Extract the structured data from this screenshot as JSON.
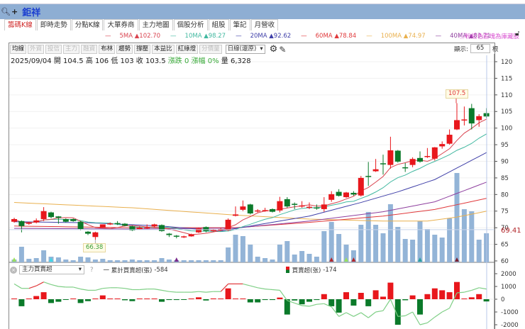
{
  "header": {
    "stock_name": "鉅祥",
    "search_icon": "magnifier",
    "add_icon": "+"
  },
  "tabs": [
    {
      "label": "籌碼K線",
      "active": true
    },
    {
      "label": "即時走勢"
    },
    {
      "label": "分點K線"
    },
    {
      "label": "大單券商"
    },
    {
      "label": "主力地圖"
    },
    {
      "label": "個股分析"
    },
    {
      "label": "組股"
    },
    {
      "label": "筆記"
    },
    {
      "label": "月營收"
    }
  ],
  "legend": [
    {
      "label": "5MA",
      "value": "▲102.70",
      "color": "#d9434f"
    },
    {
      "label": "10MA",
      "value": "▲98.27",
      "color": "#41b8a0"
    },
    {
      "label": "20MA",
      "value": "▲92.62",
      "color": "#3f3fa8"
    },
    {
      "label": "60MA",
      "value": "▲78.84",
      "color": "#e0393b"
    },
    {
      "label": "100MA",
      "value": "▲74.97",
      "color": "#e9b04e"
    },
    {
      "label": "40MA",
      "value": "▲83.71",
      "color": "#8e3f9e"
    }
  ],
  "notice": "ⓘ粉紅色區塊為庫藏股",
  "toolbar": {
    "buttons": [
      {
        "label": "均線"
      },
      {
        "label": "外資",
        "disabled": true
      },
      {
        "label": "投信",
        "disabled": true
      },
      {
        "label": "主力",
        "disabled": true
      },
      {
        "label": "融資",
        "disabled": true
      },
      {
        "label": "布林"
      },
      {
        "label": "趨勢"
      },
      {
        "label": "撐壓"
      },
      {
        "label": "本益比"
      },
      {
        "label": "紅綠燈"
      },
      {
        "label": "分價量",
        "disabled": true
      }
    ],
    "period": "日線(還原)",
    "display_label": "顯示:",
    "display_count": "65",
    "display_unit": "根"
  },
  "info": {
    "date": "2025/09/04",
    "open_label": "開",
    "open": "104.5",
    "high_label": "高",
    "high": "106",
    "low_label": "低",
    "low": "103",
    "close_label": "收",
    "close": "103.5",
    "change_label": "漲跌",
    "change": "0",
    "pct_label": "漲幅",
    "pct": "0%",
    "vol_label": "量",
    "vol": "6,328"
  },
  "lower": {
    "indicator": "主力買賣超",
    "help": "?",
    "cum_label": "一 累計買賣超(張)",
    "cum_value": "-584",
    "net_label": "買賣超(张)",
    "net_value": "-174"
  },
  "colors": {
    "up": "#e8171c",
    "down": "#0b7a2a",
    "volume": "#93b4d7",
    "cum_line": "#7fcf86"
  },
  "chart_data": {
    "type": "candlestick",
    "yticks": [
      120,
      115,
      110,
      105,
      100,
      95,
      90,
      85,
      80,
      75,
      70,
      65,
      60
    ],
    "ylim": [
      60,
      120
    ],
    "max_label": "107.5",
    "min_label": "66.38",
    "crosshair_value": "69.41",
    "ohlc": [
      [
        71.8,
        72.6,
        73,
        71.5
      ],
      [
        72,
        70.5,
        72.2,
        68.6
      ],
      [
        71.2,
        71.5,
        71.8,
        70.9
      ],
      [
        71.6,
        72.2,
        72.8,
        71.3
      ],
      [
        72.6,
        75,
        76.2,
        72
      ],
      [
        74.6,
        73.2,
        74.8,
        72.8
      ],
      [
        73.4,
        73,
        73.5,
        71.2
      ],
      [
        72.6,
        71.8,
        72.8,
        71.6
      ],
      [
        72.6,
        72,
        72.8,
        71.8
      ],
      [
        71.8,
        69.6,
        72,
        69.2
      ],
      [
        68.8,
        68.2,
        69,
        67.8
      ],
      [
        67.2,
        68.6,
        68.8,
        66.38
      ],
      [
        70,
        71,
        71,
        70
      ],
      [
        71.2,
        71.3,
        71.6,
        70.8
      ],
      [
        71.4,
        71.2,
        72,
        70.8
      ],
      [
        71.2,
        70.6,
        71.4,
        70.4
      ],
      [
        70.4,
        69.2,
        70.6,
        69
      ],
      [
        69.6,
        70,
        70.4,
        69.4
      ],
      [
        69.9,
        70.1,
        71,
        69.6
      ],
      [
        70.4,
        71,
        71.2,
        70
      ],
      [
        70.8,
        69,
        71,
        68.8
      ],
      [
        68.2,
        67.8,
        68.4,
        67.2
      ],
      [
        67.6,
        67.4,
        67.8,
        66.8
      ],
      [
        67.2,
        67.4,
        67.6,
        66.9
      ],
      [
        67.4,
        68,
        68.2,
        67.3
      ],
      [
        68.6,
        69.8,
        70,
        68.4
      ],
      [
        70.2,
        69,
        70.4,
        68.6
      ],
      [
        69,
        69.4,
        69.6,
        68.8
      ],
      [
        69.2,
        69.6,
        70,
        69
      ],
      [
        69.2,
        72.4,
        72.8,
        69
      ],
      [
        73.6,
        74,
        76.4,
        73.4
      ],
      [
        75.4,
        76.4,
        78.2,
        75
      ],
      [
        77,
        74.3,
        77.2,
        74
      ],
      [
        75,
        75.2,
        75.6,
        74.6
      ],
      [
        75.1,
        75.3,
        76,
        74.8
      ],
      [
        75.6,
        74.8,
        75.8,
        74.6
      ],
      [
        75.2,
        78,
        79.3,
        74.6
      ],
      [
        78.6,
        76.4,
        79.2,
        76
      ],
      [
        77.2,
        77,
        77.6,
        75.6
      ],
      [
        76.4,
        76.7,
        78,
        76
      ],
      [
        76,
        76.3,
        77.6,
        75.6
      ],
      [
        76.1,
        76,
        77,
        75.4
      ],
      [
        75.6,
        77,
        79.2,
        74.8
      ],
      [
        78.4,
        80.1,
        81,
        77.8
      ],
      [
        80.8,
        79.6,
        81.6,
        79.4
      ],
      [
        79.2,
        80.6,
        80.8,
        79
      ],
      [
        80.5,
        80,
        81,
        79.6
      ],
      [
        79.7,
        85,
        85.6,
        79.4
      ],
      [
        85.6,
        85.4,
        89.8,
        82.6
      ],
      [
        87,
        87.6,
        90.7,
        86.8
      ],
      [
        89.4,
        89.2,
        92,
        86
      ],
      [
        88.9,
        93.3,
        97.4,
        87.8
      ],
      [
        93.2,
        89.9,
        93.4,
        89.6
      ],
      [
        88.2,
        87.9,
        89.5,
        86.8
      ],
      [
        88.9,
        90.7,
        91.2,
        88.2
      ],
      [
        91,
        89.9,
        93,
        89.6
      ],
      [
        91.3,
        91.6,
        94,
        91
      ],
      [
        90.8,
        94.2,
        94.3,
        90.2
      ],
      [
        94.5,
        95.2,
        96,
        93.8
      ],
      [
        95.3,
        98,
        99.6,
        95
      ],
      [
        99.6,
        102.4,
        107.5,
        99.4
      ],
      [
        102.5,
        102.6,
        106.5,
        100.8
      ],
      [
        106,
        101.4,
        107.3,
        99.6
      ],
      [
        102.4,
        103.6,
        104.2,
        100.4
      ],
      [
        104.5,
        103.5,
        106,
        103
      ]
    ],
    "volume": [
      2,
      20,
      3,
      4,
      15,
      6,
      5,
      2,
      1,
      6,
      5,
      2,
      3,
      1,
      1,
      1,
      2,
      1,
      1,
      1,
      4,
      2,
      1,
      1,
      1,
      1,
      1,
      1,
      1,
      19,
      37,
      35,
      23,
      6,
      4,
      2,
      23,
      28,
      9,
      14,
      10,
      6,
      42,
      55,
      38,
      23,
      15,
      51,
      69,
      51,
      39,
      80,
      48,
      31,
      30,
      56,
      45,
      37,
      33,
      60,
      124,
      73,
      70,
      30,
      39
    ],
    "ma": {
      "ma100": [
        [
          0,
          77.6
        ],
        [
          16,
          76
        ],
        [
          30,
          73.8
        ],
        [
          40,
          72.6
        ],
        [
          50,
          72
        ],
        [
          56,
          72
        ],
        [
          60,
          73.2
        ],
        [
          64,
          74.97
        ]
      ],
      "ma60": [
        [
          0,
          70.5
        ],
        [
          16,
          70
        ],
        [
          30,
          70
        ],
        [
          40,
          71.6
        ],
        [
          50,
          73.5
        ],
        [
          57,
          75.5
        ],
        [
          64,
          78.84
        ]
      ],
      "ma40": [
        [
          0,
          69.8
        ],
        [
          16,
          69.6
        ],
        [
          30,
          69.9
        ],
        [
          40,
          72
        ],
        [
          50,
          74.8
        ],
        [
          57,
          77.8
        ],
        [
          64,
          83.71
        ]
      ],
      "ma20": [
        [
          0,
          71.8
        ],
        [
          10,
          71.5
        ],
        [
          20,
          70.5
        ],
        [
          28,
          69
        ],
        [
          32,
          70.5
        ],
        [
          40,
          73.5
        ],
        [
          47,
          77.6
        ],
        [
          52,
          80.8
        ],
        [
          57,
          84.5
        ],
        [
          64,
          92.62
        ]
      ]
    },
    "net": [
      50,
      -550,
      0,
      250,
      550,
      -300,
      -200,
      -50,
      30,
      -300,
      -150,
      0,
      300,
      50,
      30,
      -80,
      -150,
      40,
      50,
      50,
      -200,
      -60,
      -60,
      -20,
      0,
      150,
      -100,
      60,
      40,
      850,
      0,
      0,
      -250,
      -250,
      -60,
      -60,
      130,
      -1200,
      -100,
      -400,
      -200,
      -60,
      400,
      -550,
      -1050,
      550,
      -500,
      500,
      -550,
      700,
      200,
      1300,
      -2000,
      -80,
      300,
      -1200,
      400,
      850,
      700,
      550,
      1350,
      50,
      150,
      400,
      -174
    ],
    "cum": [
      1200,
      850,
      850,
      1050,
      1350,
      1150,
      1000,
      950,
      950,
      800,
      700,
      700,
      850,
      900,
      900,
      850,
      750,
      750,
      800,
      800,
      700,
      600,
      550,
      550,
      550,
      600,
      550,
      600,
      600,
      1200,
      1200,
      1200,
      1050,
      900,
      800,
      750,
      700,
      -100,
      -300,
      -500,
      -550,
      -400,
      -350,
      -600,
      -1350,
      -1050,
      -1350,
      -1050,
      -1450,
      -1000,
      -900,
      0,
      -1350,
      -1300,
      -1000,
      -2000,
      -1850,
      -1400,
      -1000,
      -700,
      500,
      550,
      700,
      900,
      800
    ],
    "lower_yticks": [
      2000,
      1000,
      0,
      -1000,
      -2000
    ]
  }
}
